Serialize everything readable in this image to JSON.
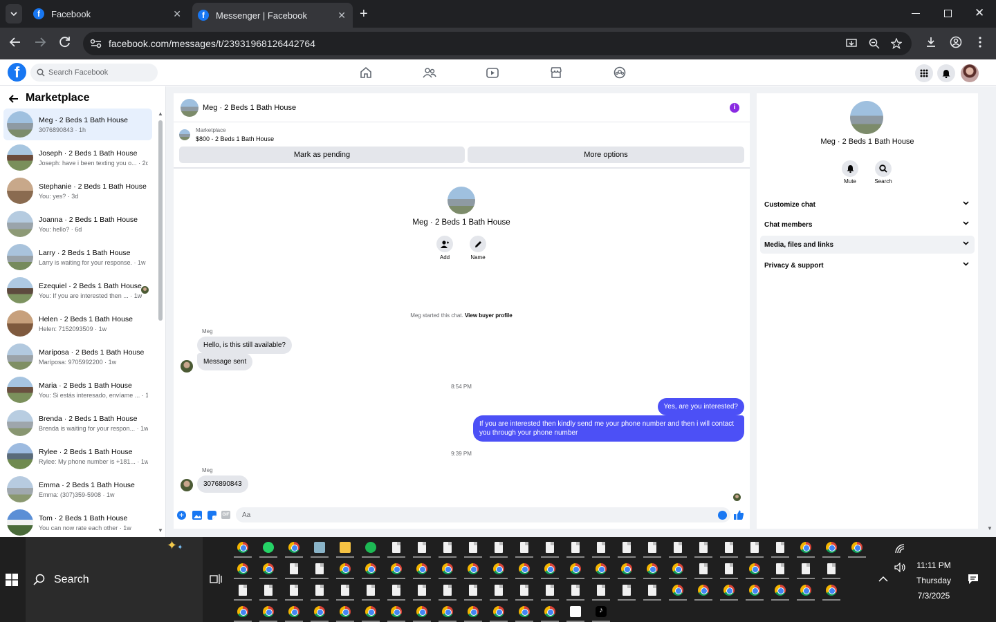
{
  "browser": {
    "tabs": [
      {
        "title": "Facebook",
        "active": false
      },
      {
        "title": "Messenger | Facebook",
        "active": true
      }
    ],
    "url": "facebook.com/messages/t/23931968126442764"
  },
  "fb": {
    "search_placeholder": "Search Facebook"
  },
  "sidebar": {
    "title": "Marketplace",
    "conversations": [
      {
        "name": "Meg · 2 Beds 1 Bath House",
        "preview": "3076890843 · 1h",
        "active": true
      },
      {
        "name": "Joseph · 2 Beds 1 Bath House",
        "preview": "Joseph: have i been texting you o... · 2d"
      },
      {
        "name": "Stephanie · 2 Beds 1 Bath House",
        "preview": "You: yes? · 3d"
      },
      {
        "name": "Joanna · 2 Beds 1 Bath House",
        "preview": "You: hello? · 6d"
      },
      {
        "name": "Larry · 2 Beds 1 Bath House",
        "preview": "Larry is waiting for your response. · 1w"
      },
      {
        "name": "Ezequiel · 2 Beds 1 Bath House",
        "preview": "You: If you are interested then ... · 1w"
      },
      {
        "name": "Helen · 2 Beds 1 Bath House",
        "preview": "Helen: 7152093509 · 1w"
      },
      {
        "name": "Maríposa · 2 Beds 1 Bath House",
        "preview": "Maríposa: 9705992200 · 1w"
      },
      {
        "name": "Maria · 2 Beds 1 Bath House",
        "preview": "You: Si estás interesado, envíame ... · 1w"
      },
      {
        "name": "Brenda · 2 Beds 1 Bath House",
        "preview": "Brenda is waiting for your respon... · 1w"
      },
      {
        "name": "Rylee · 2 Beds 1 Bath House",
        "preview": "Rylee: My phone number is +181... · 1w"
      },
      {
        "name": "Emma · 2 Beds 1 Bath House",
        "preview": "Emma: (307)359-5908 · 1w"
      },
      {
        "name": "Tom · 2 Beds 1 Bath House",
        "preview": "You can now rate each other · 1w"
      }
    ]
  },
  "chat": {
    "header_name": "Meg · 2 Beds 1 Bath House",
    "listing_label": "Marketplace",
    "listing_title": "$800 - 2 Beds 1 Bath House",
    "mark_pending": "Mark as pending",
    "more_options": "More options",
    "profile_name": "Meg · 2 Beds 1 Bath House",
    "add_label": "Add",
    "name_label": "Name",
    "started_text": "Meg started this chat.",
    "view_buyer": "View buyer profile",
    "sender1": "Meg",
    "msg1": "Hello, is this still available?",
    "msg2": "Message sent",
    "time1": "8:54 PM",
    "out1": "Yes, are you interested?",
    "out2": "If you are interested then kindly send me your phone number and then i will contact you through your phone number",
    "time2": "9:39 PM",
    "sender2": "Meg",
    "msg3": "3076890843",
    "composer_placeholder": "Aa"
  },
  "details": {
    "name": "Meg · 2 Beds 1 Bath House",
    "mute": "Mute",
    "search": "Search",
    "sections": [
      "Customize chat",
      "Chat members",
      "Media, files and links",
      "Privacy & support"
    ]
  },
  "taskbar": {
    "search": "Search",
    "time": "11:11 PM",
    "day": "Thursday",
    "date": "7/3/2025"
  },
  "colors": {
    "fb_blue": "#1877f2",
    "out_bubble": "#4c50f6",
    "info": "#8a2be2"
  }
}
